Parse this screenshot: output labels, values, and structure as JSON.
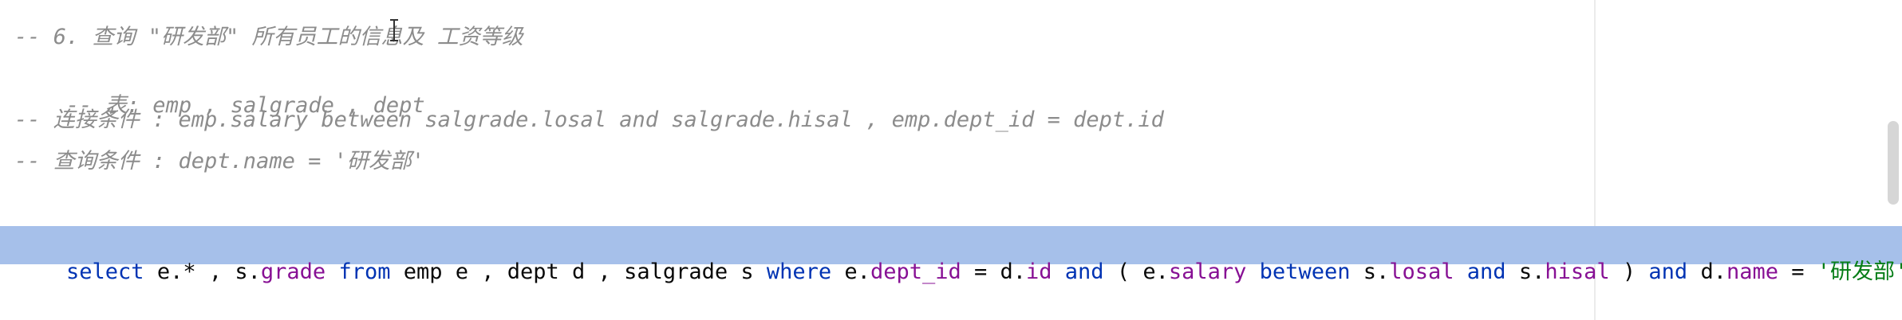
{
  "editor": {
    "comments": [
      "-- 6. 查询 \"研发部\" 所有员工的信息及 工资等级",
      "-- 表: emp , salgrade , dept",
      "-- 连接条件 : emp.salary between salgrade.losal and salgrade.hisal , emp.dept_id = dept.id",
      "-- 查询条件 : dept.name = '研发部'"
    ],
    "sql_tokens": [
      "select",
      " e.* , s.",
      "grade",
      " ",
      "from",
      " emp e , dept d , salgrade s ",
      "where",
      " e.",
      "dept_id",
      " = d.",
      "id",
      " ",
      "and",
      " ( e.",
      "salary",
      " ",
      "between",
      " s.",
      "losal",
      " ",
      "and",
      " s.",
      "hisal",
      " ) ",
      "and",
      " d.",
      "name",
      " = ",
      "'研发部'",
      ";"
    ]
  },
  "colors": {
    "comment": "#8c8c8c",
    "keyword": "#0033b3",
    "column": "#871094",
    "string": "#067d17",
    "selection": "#a6c0ea"
  },
  "icons": {
    "cursor": "text-cursor-icon"
  }
}
